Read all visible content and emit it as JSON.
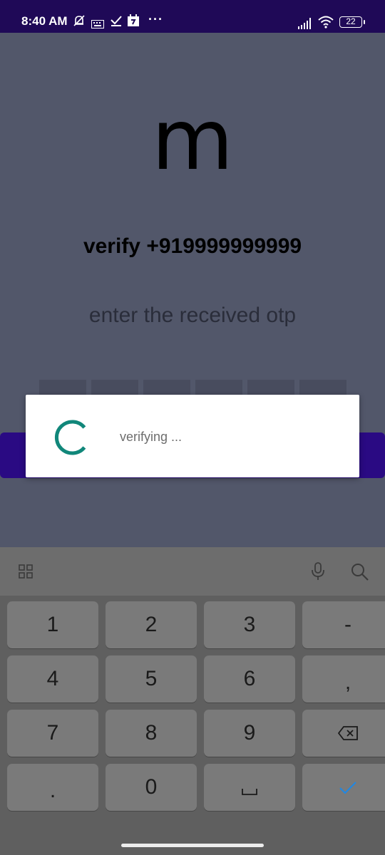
{
  "status_bar": {
    "time": "8:40 AM",
    "battery": "22",
    "icons": [
      "mute-icon",
      "keyboard-icon",
      "check-icon",
      "calendar-icon",
      "more-icon",
      "signal-icon",
      "wifi-icon",
      "battery-icon"
    ]
  },
  "app": {
    "logo": "m",
    "title": "verify +919999999999",
    "prompt": "enter the received otp"
  },
  "dialog": {
    "message": "verifying ...",
    "spinner_color": "#11877a"
  },
  "keyboard": {
    "toolbar_icons": [
      "grid-icon",
      "microphone-icon",
      "search-icon"
    ],
    "rows": [
      [
        "1",
        "2",
        "3",
        "-"
      ],
      [
        "4",
        "5",
        "6",
        ","
      ],
      [
        "7",
        "8",
        "9",
        "backspace"
      ],
      [
        ".",
        "0",
        "space",
        "done"
      ]
    ]
  },
  "colors": {
    "status_bar": "#1f0957",
    "accent": "#2a0a83",
    "spinner": "#11877a",
    "done_key": "#1e88e5"
  }
}
